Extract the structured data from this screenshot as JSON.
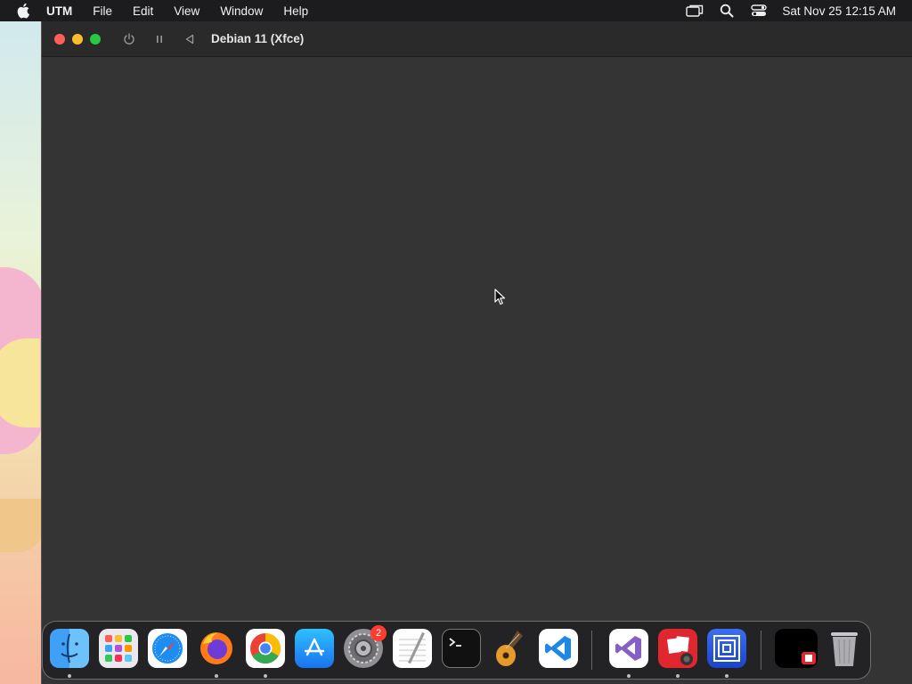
{
  "menubar": {
    "app_name": "UTM",
    "items": [
      "File",
      "Edit",
      "View",
      "Window",
      "Help"
    ],
    "clock": "Sat Nov 25  12:15 AM"
  },
  "window": {
    "title": "Debian 11 (Xfce)"
  },
  "dock": {
    "apps": [
      {
        "name": "Finder",
        "running": true
      },
      {
        "name": "Launchpad",
        "running": false
      },
      {
        "name": "Safari",
        "running": false
      },
      {
        "name": "Firefox",
        "running": true
      },
      {
        "name": "Google Chrome",
        "running": true
      },
      {
        "name": "App Store",
        "running": false
      },
      {
        "name": "System Settings",
        "running": false,
        "badge": "2"
      },
      {
        "name": "TextEdit",
        "running": false
      },
      {
        "name": "Terminal",
        "running": false
      },
      {
        "name": "GarageBand",
        "running": false
      },
      {
        "name": "Visual Studio Code",
        "running": false
      },
      {
        "name": "Visual Studio",
        "running": true
      },
      {
        "name": "Photo Booth",
        "running": true
      },
      {
        "name": "UTM",
        "running": true
      },
      {
        "name": "Minimized Window",
        "running": false
      },
      {
        "name": "Trash",
        "running": false
      }
    ]
  }
}
